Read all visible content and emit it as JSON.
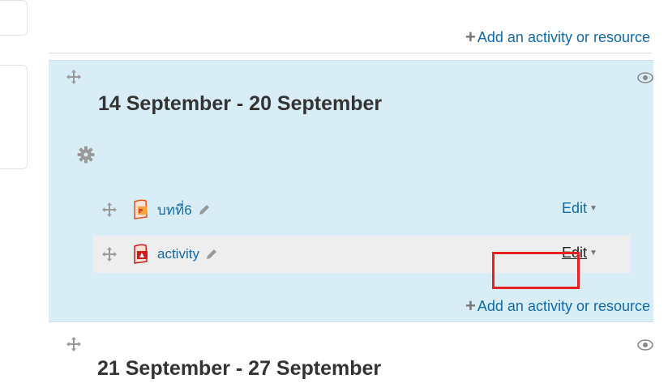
{
  "add_activity_label": "Add an activity or resource",
  "section": {
    "title": "14 September - 20 September",
    "activities": [
      {
        "name": "บทที่6",
        "icon": "powerpoint-file-icon",
        "edit_label": "Edit"
      },
      {
        "name": "activity",
        "icon": "pdf-file-icon",
        "edit_label": "Edit"
      }
    ]
  },
  "next_section": {
    "title": "21 September - 27 September"
  },
  "colors": {
    "section_bg": "#d9edf7",
    "link": "#0f6aa8",
    "highlight_box": "#e52222",
    "row_highlight": "#eeeeee"
  }
}
